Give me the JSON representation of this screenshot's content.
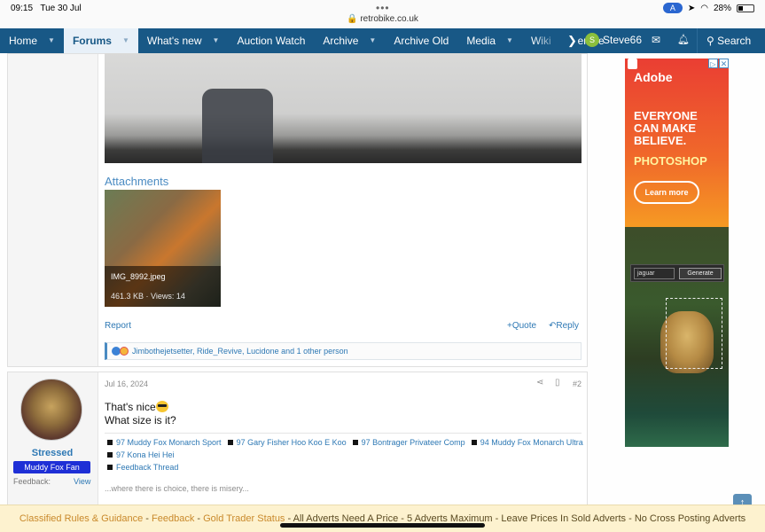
{
  "status": {
    "time": "09:15",
    "date": "Tue 30 Jul",
    "url": "retrobike.co.uk",
    "battery": "28%"
  },
  "nav": {
    "items": [
      {
        "label": "Home",
        "caret": true
      },
      {
        "label": "Forums",
        "caret": true,
        "active": true
      },
      {
        "label": "What's new",
        "caret": true
      },
      {
        "label": "Auction Watch",
        "caret": false
      },
      {
        "label": "Archive",
        "caret": true
      },
      {
        "label": "Archive Old",
        "caret": false
      },
      {
        "label": "Media",
        "caret": true
      },
      {
        "label": "Wiki",
        "caret": false
      },
      {
        "label": "Membe",
        "caret": false
      }
    ],
    "user_initial": "S",
    "user_name": "Steve66",
    "search_label": "Search"
  },
  "post1": {
    "attachments_title": "Attachments",
    "attachment": {
      "filename": "IMG_8992.jpeg",
      "meta": "461.3 KB · Views: 14"
    },
    "report_label": "Report",
    "quote_label": "Quote",
    "reply_label": "Reply",
    "reactions_text": "Jimbothejetsetter, Ride_Revive, Lucidone and 1 other person"
  },
  "post2": {
    "username": "Stressed",
    "user_title": "Muddy Fox Fan",
    "feedback_label": "Feedback:",
    "feedback_view": "View",
    "date": "Jul 16, 2024",
    "post_number": "#2",
    "line1": "That's nice",
    "line2": "What size is it?",
    "signature_links": [
      "97 Muddy Fox Monarch Sport",
      "97 Gary Fisher Hoo Koo E Koo",
      "97 Bontrager Privateer Comp",
      "94 Muddy Fox Monarch Ultra",
      "97 Kona Hei Hei",
      "Feedback Thread"
    ],
    "signature_quote": "...where there is choice, there is misery..."
  },
  "ad": {
    "brand": "Adobe",
    "headline": "EVERYONE CAN MAKE BELIEVE.",
    "product": "PHOTOSHOP",
    "cta": "Learn more",
    "prompt_value": "jaguar",
    "generate_label": "Generate"
  },
  "notice": {
    "links": [
      {
        "text": "Classified Rules & Guidance",
        "style": "a"
      },
      {
        "text": "Feedback",
        "style": "a"
      },
      {
        "text": "Gold Trader Status",
        "style": "a"
      },
      {
        "text": "All Adverts Need A Price",
        "style": "d"
      },
      {
        "text": "5 Adverts Maximum",
        "style": "d"
      },
      {
        "text": "Leave Prices In Sold Adverts",
        "style": "d"
      },
      {
        "text": "No Cross Posting Adverts",
        "style": "d"
      }
    ],
    "separator": " - "
  },
  "colors": {
    "nav_bg": "#185886",
    "link": "#2d78b4",
    "user_title_bg": "#1e2fd6",
    "notice_bg": "#fdf2cf"
  }
}
